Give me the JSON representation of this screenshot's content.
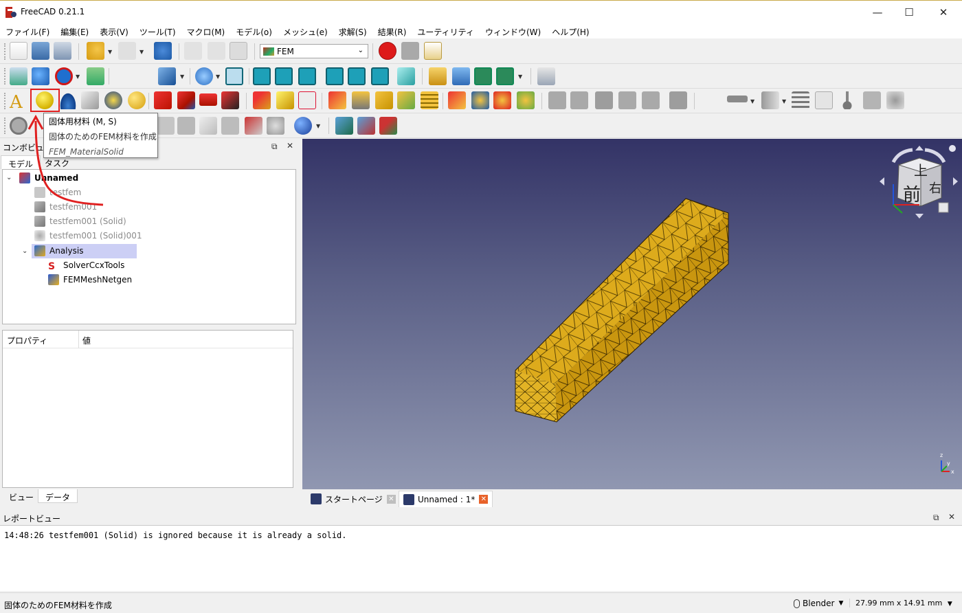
{
  "window": {
    "title": "FreeCAD 0.21.1",
    "minimize": "—",
    "maximize": "☐",
    "close": "✕"
  },
  "menu": [
    "ファイル(F)",
    "編集(E)",
    "表示(V)",
    "ツール(T)",
    "マクロ(M)",
    "モデル(o)",
    "メッシュ(e)",
    "求解(S)",
    "結果(R)",
    "ユーティリティ",
    "ウィンドウ(W)",
    "ヘルプ(H)"
  ],
  "workbench": {
    "selected": "FEM"
  },
  "tooltip": {
    "title": "固体用材料 (M, S)",
    "description": "固体のためのFEM材料を作成",
    "command": "FEM_MaterialSolid"
  },
  "combo_view": {
    "title": "コンボビュー",
    "tabs": [
      "モデル",
      "タスク"
    ],
    "tree": {
      "root": "Unnamed",
      "items": [
        "testfem",
        "testfem001",
        "testfem001 (Solid)",
        "testfem001 (Solid)001"
      ],
      "analysis": "Analysis",
      "analysis_children": [
        "SolverCcxTools",
        "FEMMeshNetgen"
      ]
    },
    "properties": {
      "col_property": "プロパティ",
      "col_value": "値"
    },
    "bottom_tabs": [
      "ビュー",
      "データ"
    ]
  },
  "navcube": {
    "top": "上",
    "front": "前",
    "right": "右"
  },
  "axes": {
    "x": "x",
    "y": "y",
    "z": "z"
  },
  "document_tabs": [
    {
      "label": "スタートページ"
    },
    {
      "label": "Unnamed : 1*"
    }
  ],
  "report_view": {
    "title": "レポートビュー",
    "lines": [
      "14:48:26  testfem001 (Solid) is ignored because it is already a solid."
    ]
  },
  "statusbar": {
    "message": "固体のためのFEM材料を作成",
    "navigation": "Blender",
    "dimensions": "27.99 mm x 14.91 mm"
  },
  "colors": {
    "accent_red": "#e02020",
    "solid_fill": "#d4a019",
    "selection": "#cccff5"
  }
}
